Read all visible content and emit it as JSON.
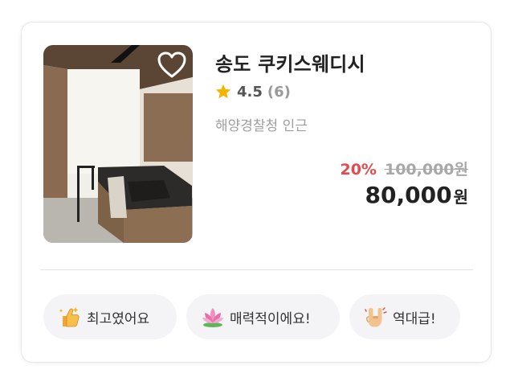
{
  "listing": {
    "name": "송도 쿠키스웨디시",
    "rating": "4.5",
    "review_count": "(6)",
    "location": "해양경찰청 인근",
    "discount": "20%",
    "original_price": "100,000원",
    "final_price": "80,000",
    "currency": "원",
    "favorite_icon": "heart-outline-icon",
    "rating_icon": "star-icon"
  },
  "reactions": [
    {
      "label": "최고였어요",
      "icon": "thumbs-up-sparkle-icon"
    },
    {
      "label": "매력적이에요!",
      "icon": "lotus-icon"
    },
    {
      "label": "역대급!",
      "icon": "rock-on-hand-icon"
    }
  ],
  "colors": {
    "discount": "#e5484d",
    "star": "#f5b400",
    "chip_bg": "#f4f4f6",
    "divider": "#e3e3e3"
  }
}
